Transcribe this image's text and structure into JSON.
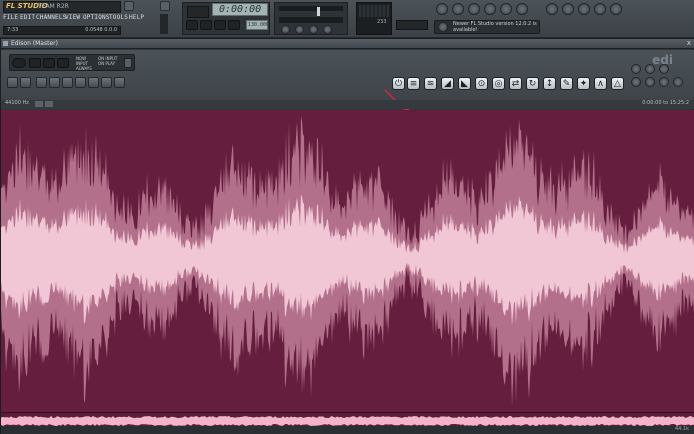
{
  "app": {
    "title_logo": "FL STUDIO",
    "team_label": "TEAM R2R",
    "menu": [
      "FILE",
      "EDIT",
      "CHANNELS",
      "VIEW",
      "OPTIONS",
      "TOOLS",
      "HELP"
    ],
    "hint_left": "7:33",
    "hint_right": "0.0548 0.0.0",
    "time_display": "0:00:00",
    "tempo": "130.000",
    "cpu_value": "233",
    "update_notice": "Newer FL Studio version 12.0.2 is available!"
  },
  "edison": {
    "title": "Edison (Master)",
    "brand": "edi",
    "close_label": "x",
    "record_options": [
      "NOW",
      "ON INPUT",
      "ON PLAY",
      "INPUT",
      "ON PLAY",
      "ALWAYS"
    ],
    "sample_rate": "44100 Hz",
    "selection_range": "0:00:00 to 15:25:2",
    "status_left": "",
    "status_right": "44.1k"
  },
  "colors": {
    "wave_background": "#651e3e",
    "wave_fill": "#f2b4c9",
    "wave_center": "#fbd6e2",
    "annotation_arrow": "#d4263a"
  },
  "icons": {
    "edit_tools": [
      "power-icon",
      "noise-icon",
      "eq-icon",
      "reverb-icon",
      "spectral-icon",
      "denoise-icon",
      "blur-icon",
      "stretch-icon",
      "loop-icon",
      "normalize-icon",
      "trim-icon",
      "fade-icon",
      "amp-icon",
      "pencil-icon",
      "wand-icon",
      "envelope-icon",
      "mark-icon",
      "shuffle-icon",
      "settings-icon"
    ]
  }
}
